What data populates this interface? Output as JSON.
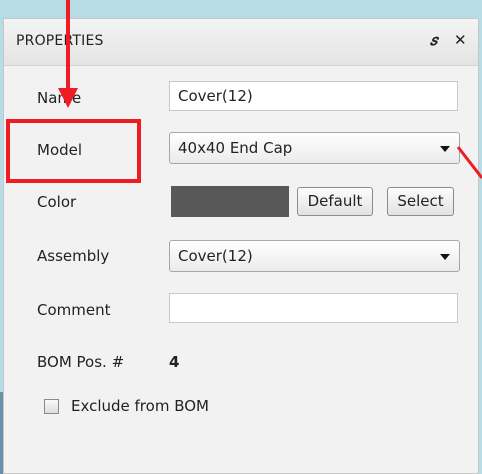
{
  "panel": {
    "title": "PROPERTIES",
    "float_glyph": "Б",
    "close_glyph": "✕"
  },
  "fields": {
    "name_label": "Name",
    "name_value": "Cover(12)",
    "model_label": "Model",
    "model_value": "40x40 End Cap",
    "color_label": "Color",
    "color_value": "#585858",
    "default_button": "Default",
    "select_button": "Select",
    "assembly_label": "Assembly",
    "assembly_value": "Cover(12)",
    "comment_label": "Comment",
    "comment_value": "",
    "bom_label": "BOM Pos. #",
    "bom_value": "4",
    "exclude_label": "Exclude from BOM",
    "exclude_checked": false
  },
  "icons": {
    "float": "float-window-icon",
    "close": "close-icon",
    "dropdown": "chevron-down-icon"
  },
  "annotation": {
    "highlight_color": "#ee1c23"
  }
}
